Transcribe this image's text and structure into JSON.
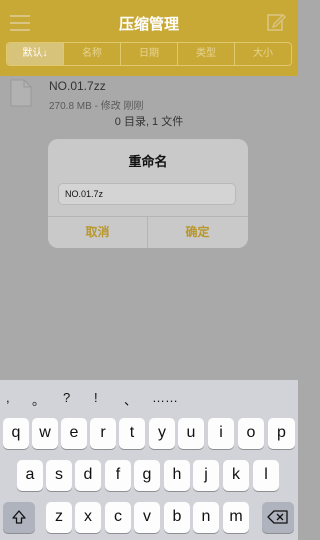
{
  "header": {
    "title": "压缩管理",
    "sort_tabs": [
      "默认↓",
      "名称",
      "日期",
      "类型",
      "大小"
    ]
  },
  "file": {
    "name": "NO.01.7zz",
    "meta": "270.8 MB - 修改 刚刚"
  },
  "summary": "0 目录, 1 文件",
  "dialog": {
    "title": "重命名",
    "input_value": "NO.01.7z",
    "cancel_label": "取消",
    "ok_label": "确定"
  },
  "keyboard": {
    "punctuation": [
      ",",
      "。",
      "?",
      "!",
      "、",
      "……"
    ],
    "row1": [
      "q",
      "w",
      "e",
      "r",
      "t",
      "y",
      "u",
      "i",
      "o",
      "p"
    ],
    "row2": [
      "a",
      "s",
      "d",
      "f",
      "g",
      "h",
      "j",
      "k",
      "l"
    ],
    "row3": [
      "z",
      "x",
      "c",
      "v",
      "b",
      "n",
      "m"
    ],
    "shift_icon": "shift-icon",
    "delete_icon": "delete-icon"
  },
  "colors": {
    "header_bg": "#c9a936",
    "accent": "#b9972b",
    "dim_bg": "#a9a9a9"
  }
}
